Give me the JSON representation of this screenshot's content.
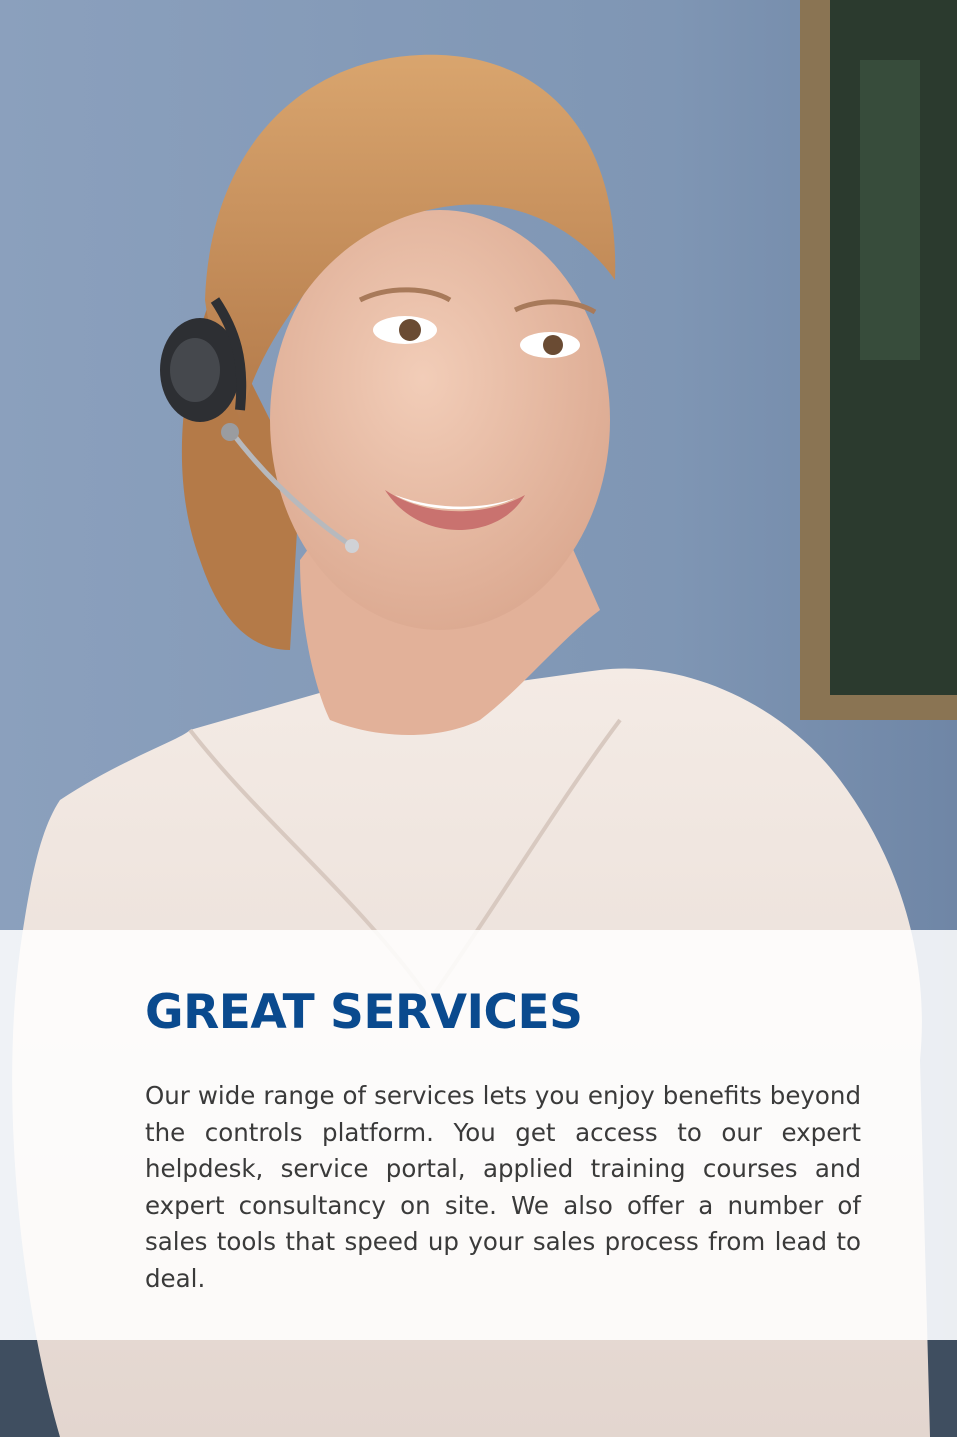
{
  "heading": "GREAT SERVICES",
  "body": "Our wide range of services lets you enjoy benefits beyond the controls platform. You get access to our expert helpdesk, service portal, applied training courses and expert consultancy on site. We also offer a number of sales tools that speed up your sales process from lead to deal.",
  "colors": {
    "heading": "#0a4a8e",
    "background": "#7d94b4",
    "panel": "#ffffff"
  }
}
